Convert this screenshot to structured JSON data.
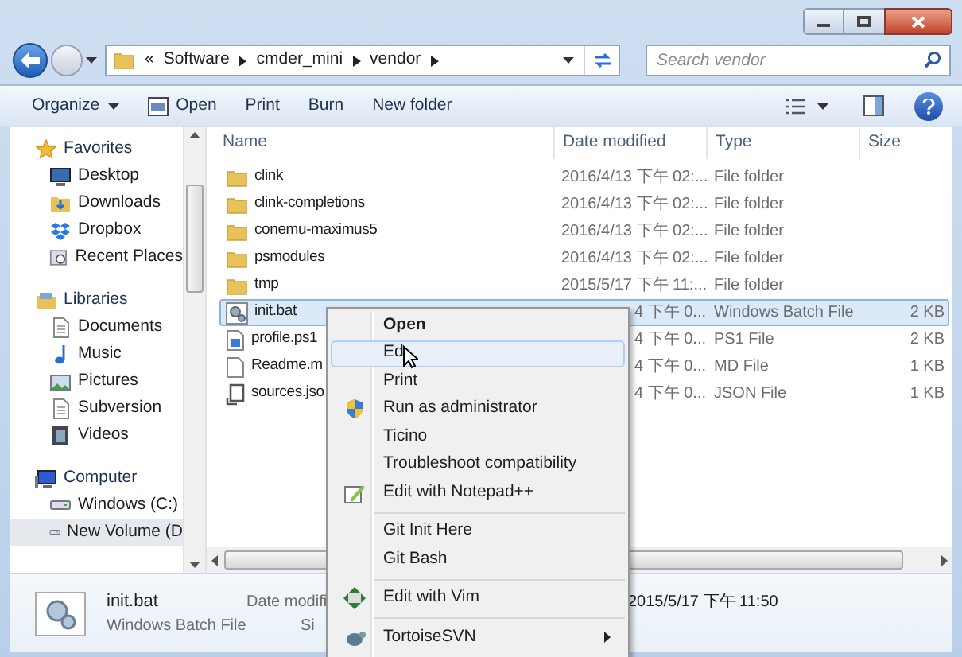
{
  "address": {
    "overflow": "«",
    "crumbs": [
      "Software",
      "cmder_mini",
      "vendor"
    ]
  },
  "search": {
    "placeholder": "Search vendor"
  },
  "toolbar": {
    "items": [
      {
        "label": "Organize",
        "dropdown": true
      },
      {
        "label": "Open",
        "dropdown": false
      },
      {
        "label": "Print",
        "dropdown": false
      },
      {
        "label": "Burn",
        "dropdown": false
      },
      {
        "label": "New folder",
        "dropdown": false
      }
    ]
  },
  "sidebar": {
    "groups": [
      {
        "label": "Favorites",
        "children": [
          {
            "label": "Desktop",
            "selected": false
          },
          {
            "label": "Downloads",
            "selected": false
          },
          {
            "label": "Dropbox",
            "selected": false
          },
          {
            "label": "Recent Places",
            "selected": false
          }
        ]
      },
      {
        "label": "Libraries",
        "children": [
          {
            "label": "Documents",
            "selected": false
          },
          {
            "label": "Music",
            "selected": false
          },
          {
            "label": "Pictures",
            "selected": false
          },
          {
            "label": "Subversion",
            "selected": false
          },
          {
            "label": "Videos",
            "selected": false
          }
        ]
      },
      {
        "label": "Computer",
        "children": [
          {
            "label": "Windows  (C:)",
            "selected": false
          },
          {
            "label": "New Volume (D",
            "selected": true
          }
        ]
      }
    ]
  },
  "table": {
    "columns": [
      "Name",
      "Date modified",
      "Type",
      "Size"
    ],
    "rows": [
      {
        "kind": "folder",
        "name": "clink",
        "date": "2016/4/13 下午 02:...",
        "type": "File folder",
        "size": "",
        "selected": false,
        "covered": false
      },
      {
        "kind": "folder",
        "name": "clink-completions",
        "date": "2016/4/13 下午 02:...",
        "type": "File folder",
        "size": "",
        "selected": false,
        "covered": false
      },
      {
        "kind": "folder",
        "name": "conemu-maximus5",
        "date": "2016/4/13 下午 02:...",
        "type": "File folder",
        "size": "",
        "selected": false,
        "covered": false
      },
      {
        "kind": "folder",
        "name": "psmodules",
        "date": "2016/4/13 下午 02:...",
        "type": "File folder",
        "size": "",
        "selected": false,
        "covered": false
      },
      {
        "kind": "folder",
        "name": "tmp",
        "date": "2015/5/17 下午 11:...",
        "type": "File folder",
        "size": "",
        "selected": false,
        "covered": false
      },
      {
        "kind": "batch",
        "name": "init.bat",
        "date": "4 下午 0...",
        "type": "Windows Batch File",
        "size": "2 KB",
        "selected": true,
        "covered": true
      },
      {
        "kind": "script",
        "name": "profile.ps1",
        "date": "4 下午 0...",
        "type": "PS1 File",
        "size": "2 KB",
        "selected": false,
        "covered": true
      },
      {
        "kind": "document",
        "name": "Readme.m",
        "date": "4 下午 0...",
        "type": "MD File",
        "size": "1 KB",
        "selected": false,
        "covered": true
      },
      {
        "kind": "json",
        "name": "sources.jso",
        "date": "4 下午 0...",
        "type": "JSON File",
        "size": "1 KB",
        "selected": false,
        "covered": true
      }
    ]
  },
  "details": {
    "name": "init.bat",
    "type": "Windows Batch File",
    "date_label": "Date modifi",
    "size_label": "Si",
    "date": "2015/5/17 下午 11:50"
  },
  "context_menu": {
    "sections": [
      [
        {
          "label": "Open",
          "default": true,
          "selected": false,
          "submenu": false
        },
        {
          "label": "Ed",
          "default": false,
          "selected": true,
          "submenu": false
        },
        {
          "label": "Print",
          "default": false,
          "selected": false,
          "submenu": false
        },
        {
          "label": "Run as administrator",
          "default": false,
          "selected": false,
          "submenu": false
        },
        {
          "label": "Ticino",
          "default": false,
          "selected": false,
          "submenu": false
        },
        {
          "label": "Troubleshoot compatibility",
          "default": false,
          "selected": false,
          "submenu": false
        },
        {
          "label": "Edit with Notepad++",
          "default": false,
          "selected": false,
          "submenu": false
        }
      ],
      [
        {
          "label": "Git Init Here",
          "default": false,
          "selected": false,
          "submenu": false
        },
        {
          "label": "Git Bash",
          "default": false,
          "selected": false,
          "submenu": false
        }
      ],
      [
        {
          "label": "Edit with Vim",
          "default": false,
          "selected": false,
          "submenu": false
        }
      ],
      [
        {
          "label": "TortoiseSVN",
          "default": false,
          "selected": false,
          "submenu": true
        }
      ]
    ]
  }
}
